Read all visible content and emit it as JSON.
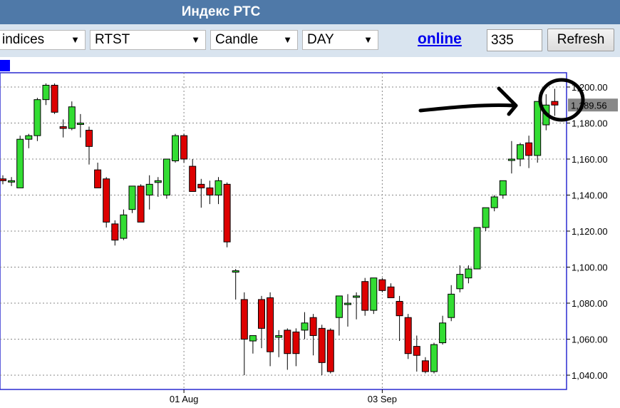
{
  "window": {
    "title": "Индекс РТС"
  },
  "toolbar": {
    "category_select": "indices",
    "symbol_select": "RTST",
    "chart_type_select": "Candle",
    "period_select": "DAY",
    "online_link": "online",
    "count_value": "335",
    "refresh_label": "Refresh"
  },
  "colors": {
    "up": "#33dd33",
    "down": "#dd0000",
    "header": "#4f79a8",
    "toolbar": "#d9e4ef"
  },
  "chart_data": {
    "type": "candlestick",
    "title": "",
    "ylim": [
      1035,
      1205
    ],
    "yticks": [
      1040,
      1060,
      1080,
      1100,
      1120,
      1140,
      1160,
      1180,
      1200
    ],
    "ytick_labels": [
      "1,040.00",
      "1,060.00",
      "1,080.00",
      "1,100.00",
      "1,120.00",
      "1,140.00",
      "1,160.00",
      "1,180.00",
      "1,200.00"
    ],
    "xtick_labels": [
      {
        "label": "01 Aug",
        "index": 21
      },
      {
        "label": "03 Sep",
        "index": 44
      }
    ],
    "current_price_label": "1,189.56",
    "grid": true,
    "ohlc": [
      [
        1149,
        1151,
        1146,
        1148
      ],
      [
        1148,
        1150,
        1145,
        1148
      ],
      [
        1144,
        1173,
        1144,
        1171
      ],
      [
        1171,
        1174,
        1166,
        1173
      ],
      [
        1173,
        1194,
        1170,
        1193
      ],
      [
        1193,
        1202,
        1190,
        1201
      ],
      [
        1201,
        1202,
        1185,
        1186
      ],
      [
        1178,
        1182,
        1172,
        1177
      ],
      [
        1177,
        1192,
        1176,
        1189
      ],
      [
        1180,
        1185,
        1172,
        1180
      ],
      [
        1176,
        1178,
        1157,
        1167
      ],
      [
        1154,
        1158,
        1146,
        1144
      ],
      [
        1149,
        1150,
        1122,
        1125
      ],
      [
        1124,
        1126,
        1112,
        1115
      ],
      [
        1116,
        1132,
        1115,
        1129
      ],
      [
        1132,
        1145,
        1130,
        1145
      ],
      [
        1145,
        1146,
        1126,
        1125
      ],
      [
        1140,
        1151,
        1132,
        1146
      ],
      [
        1147,
        1150,
        1139,
        1148
      ],
      [
        1140,
        1160,
        1138,
        1160
      ],
      [
        1159,
        1174,
        1158,
        1173
      ],
      [
        1173,
        1174,
        1158,
        1160
      ],
      [
        1156,
        1160,
        1148,
        1142
      ],
      [
        1146,
        1149,
        1133,
        1144
      ],
      [
        1144,
        1148,
        1135,
        1140
      ],
      [
        1140,
        1150,
        1135,
        1148
      ],
      [
        1146,
        1147,
        1111,
        1114
      ],
      [
        1098,
        1099,
        1082,
        1098
      ],
      [
        1082,
        1086,
        1040,
        1060
      ],
      [
        1059,
        1062,
        1052,
        1062
      ],
      [
        1082,
        1084,
        1055,
        1066
      ],
      [
        1083,
        1086,
        1045,
        1053
      ],
      [
        1061,
        1065,
        1050,
        1062
      ],
      [
        1065,
        1066,
        1043,
        1052
      ],
      [
        1064,
        1066,
        1045,
        1052
      ],
      [
        1065,
        1075,
        1060,
        1069
      ],
      [
        1072,
        1074,
        1051,
        1062
      ],
      [
        1066,
        1068,
        1040,
        1047
      ],
      [
        1065,
        1066,
        1041,
        1042
      ],
      [
        1072,
        1083,
        1062,
        1084
      ],
      [
        1080,
        1085,
        1067,
        1080
      ],
      [
        1084,
        1086,
        1071,
        1084
      ],
      [
        1092,
        1094,
        1073,
        1076
      ],
      [
        1076,
        1093,
        1074,
        1094
      ],
      [
        1093,
        1094,
        1086,
        1087
      ],
      [
        1089,
        1091,
        1085,
        1083
      ],
      [
        1081,
        1084,
        1059,
        1073
      ],
      [
        1072,
        1074,
        1049,
        1052
      ],
      [
        1056,
        1062,
        1042,
        1051
      ],
      [
        1048,
        1050,
        1041,
        1042
      ],
      [
        1042,
        1058,
        1041,
        1057
      ],
      [
        1058,
        1073,
        1057,
        1069
      ],
      [
        1072,
        1090,
        1070,
        1085
      ],
      [
        1088,
        1101,
        1086,
        1096
      ],
      [
        1094,
        1101,
        1091,
        1099
      ],
      [
        1099,
        1122,
        1099,
        1122
      ],
      [
        1122,
        1133,
        1120,
        1133
      ],
      [
        1133,
        1140,
        1131,
        1139
      ],
      [
        1140,
        1148,
        1138,
        1148
      ],
      [
        1160,
        1170,
        1152,
        1160
      ],
      [
        1160,
        1169,
        1156,
        1168
      ],
      [
        1169,
        1173,
        1155,
        1162
      ],
      [
        1162,
        1191,
        1158,
        1192
      ],
      [
        1179,
        1196,
        1176,
        1190
      ],
      [
        1192,
        1199,
        1184,
        1190
      ]
    ]
  }
}
